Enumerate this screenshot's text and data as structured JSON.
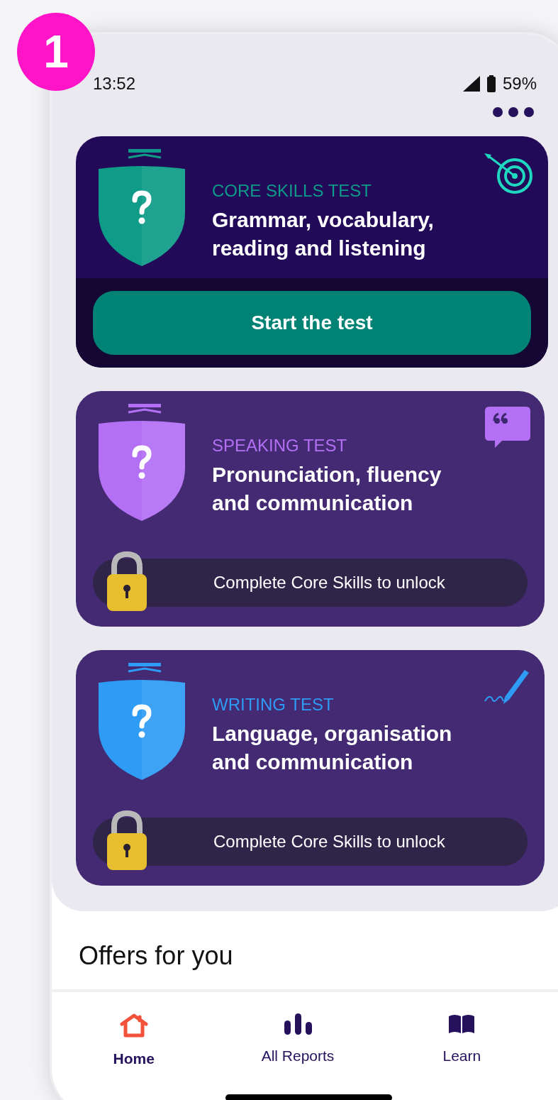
{
  "step_badge": "1",
  "status_bar": {
    "time": "13:52",
    "battery": "59%"
  },
  "tests": [
    {
      "kind": "start",
      "color": "#0e9b88",
      "label": "CORE SKILLS TEST",
      "title": "Grammar, vocabulary, reading and listening",
      "action": "Start the test"
    },
    {
      "kind": "locked",
      "color": "#b470f5",
      "label": "SPEAKING TEST",
      "title": "Pronunciation, fluency and communication",
      "action": "Complete Core Skills to unlock"
    },
    {
      "kind": "locked",
      "color": "#2e9bf5",
      "label": "WRITING TEST",
      "title": "Language, organisation and communication",
      "action": "Complete Core Skills to unlock"
    }
  ],
  "offers_heading": "Offers for you",
  "nav": [
    {
      "label": "Home",
      "selected": true
    },
    {
      "label": "All Reports",
      "selected": false
    },
    {
      "label": "Learn",
      "selected": false
    }
  ]
}
